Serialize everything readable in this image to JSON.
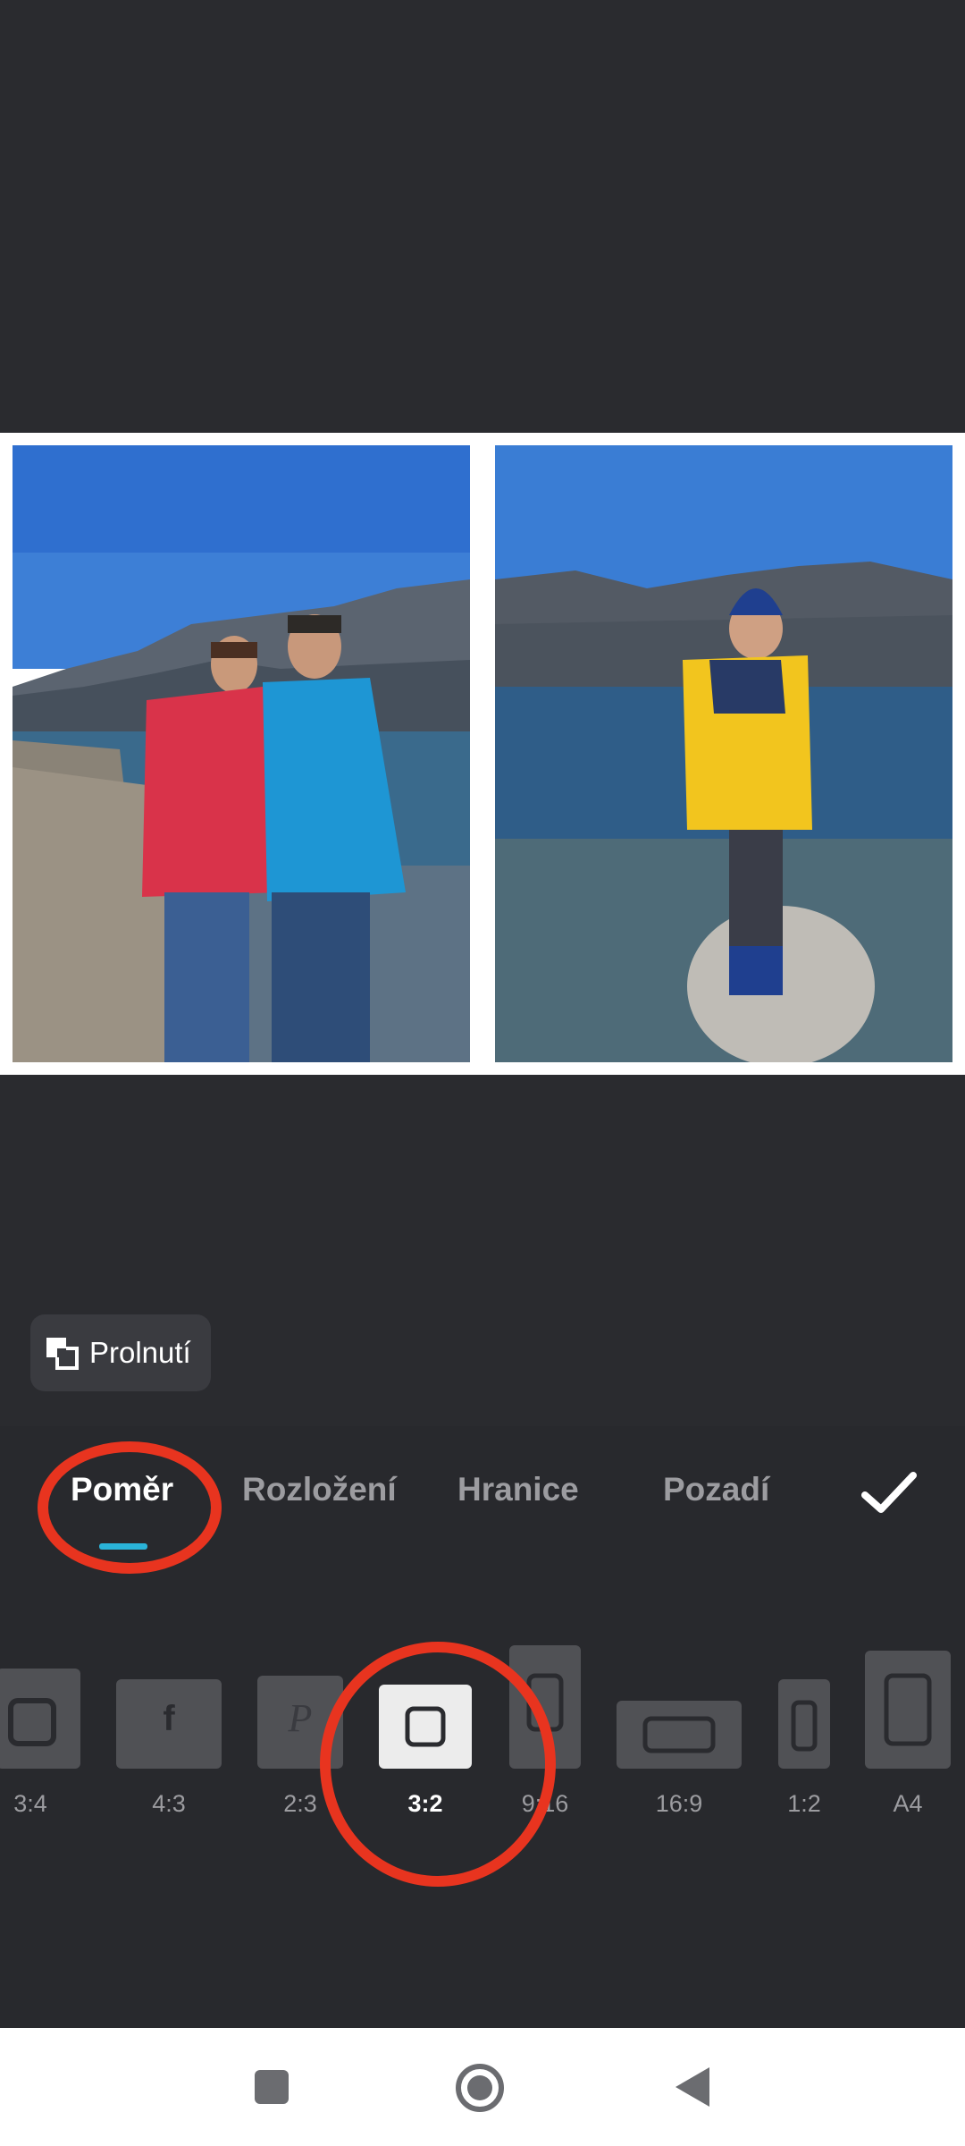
{
  "blend_button": {
    "label": "Prolnutí",
    "icon": "blend-icon"
  },
  "tabs": [
    {
      "label": "Poměr",
      "active": true
    },
    {
      "label": "Rozložení",
      "active": false
    },
    {
      "label": "Hranice",
      "active": false
    },
    {
      "label": "Pozadí",
      "active": false
    }
  ],
  "confirm_icon": "check-icon",
  "ratios": [
    {
      "label": "3:4",
      "icon": "ratio-3-4-icon"
    },
    {
      "label": "4:3",
      "icon": "facebook-icon"
    },
    {
      "label": "2:3",
      "icon": "pinterest-icon"
    },
    {
      "label": "3:2",
      "icon": "square-icon",
      "selected": true
    },
    {
      "label": "9:16",
      "icon": "ratio-9-16-icon"
    },
    {
      "label": "16:9",
      "icon": "ratio-16-9-icon"
    },
    {
      "label": "1:2",
      "icon": "ratio-1-2-icon"
    },
    {
      "label": "A4",
      "icon": "ratio-a4-icon"
    }
  ],
  "colors": {
    "accent": "#2ab3d8",
    "annotation": "#e8341f",
    "background": "#2a2b2f"
  }
}
